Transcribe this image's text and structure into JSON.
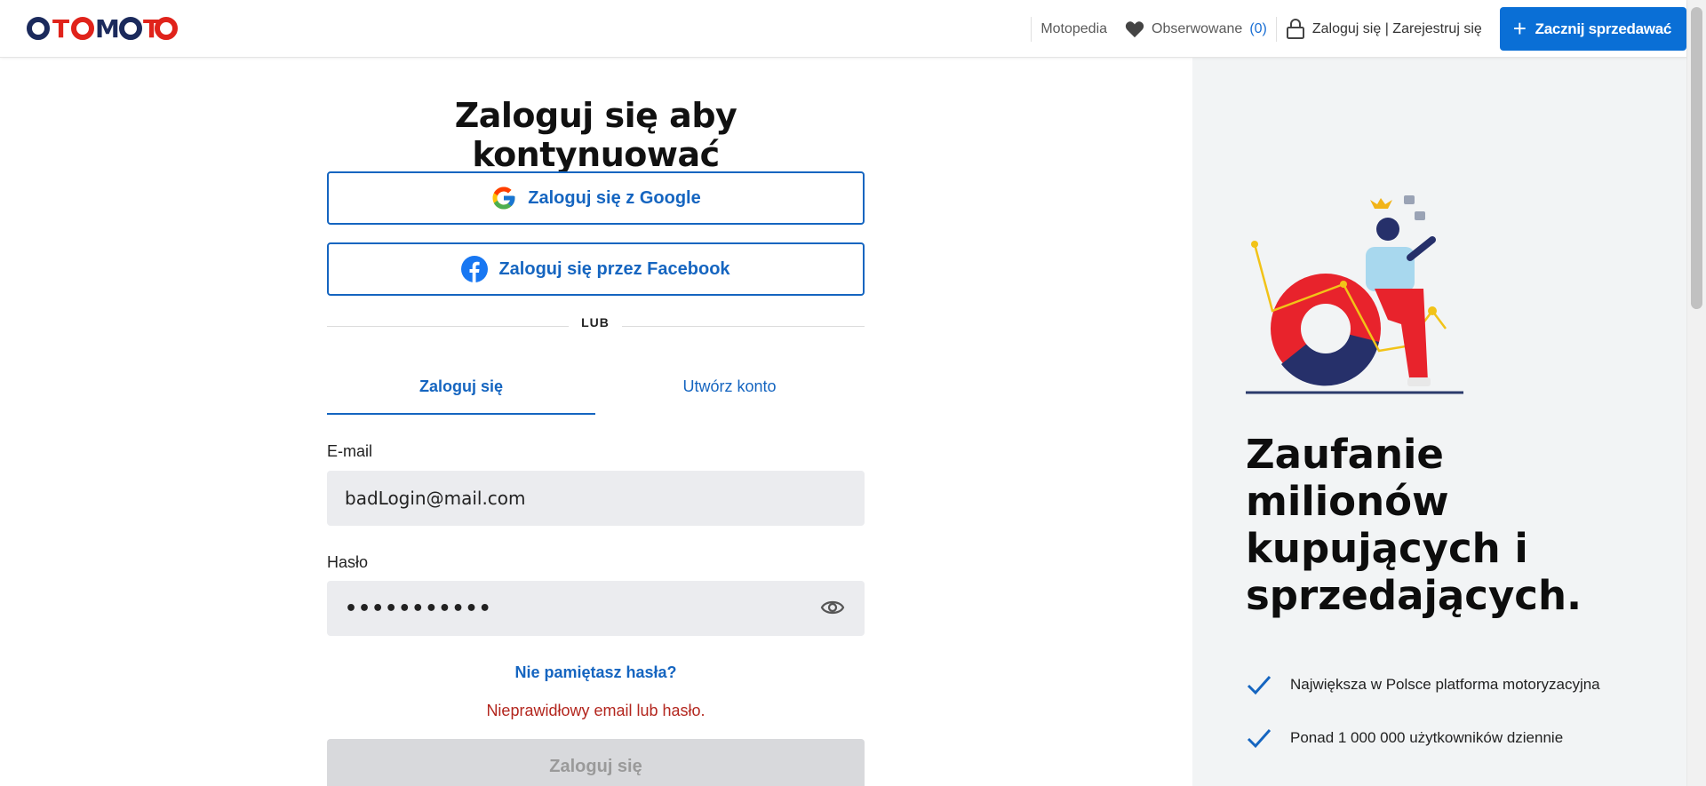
{
  "header": {
    "logo_text": "OTOMOTO",
    "motopedia": "Motopedia",
    "watched_label": "Obserwowane",
    "watched_count": "(0)",
    "login_register": "Zaloguj się | Zarejestruj się",
    "sell_button": "Zacznij sprzedawać"
  },
  "form": {
    "title": "Zaloguj się aby kontynuować",
    "google_button": "Zaloguj się z Google",
    "facebook_button": "Zaloguj się przez Facebook",
    "separator": "LUB",
    "tabs": [
      {
        "label": "Zaloguj się",
        "active": true
      },
      {
        "label": "Utwórz konto",
        "active": false
      }
    ],
    "email_label": "E-mail",
    "email_value": "badLogin@mail.com",
    "password_label": "Hasło",
    "password_value": "•••••••••••",
    "forgot_link": "Nie pamiętasz hasła?",
    "error_message": "Nieprawidłowy email lub hasło.",
    "submit_button": "Zaloguj się"
  },
  "side": {
    "heading": "Zaufanie milionów kupujących i sprzedających.",
    "features": [
      "Największa w Polsce platforma motoryzacyjna",
      "Ponad 1 000 000 użytkowników dziennie"
    ]
  },
  "colors": {
    "brand_blue": "#0a6fd6",
    "link_blue": "#1565c0",
    "error_red": "#b3261e",
    "logo_red": "#e0231b",
    "logo_navy": "#1b2a5c"
  }
}
